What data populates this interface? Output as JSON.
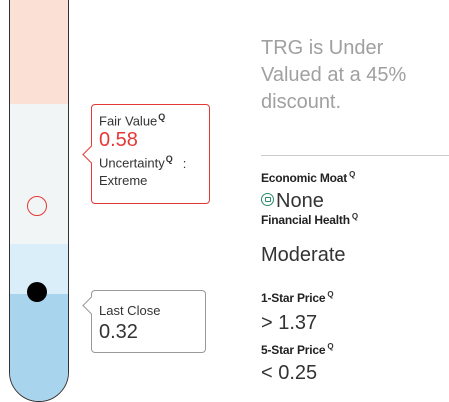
{
  "fair_value": {
    "label": "Fair Value",
    "value": "0.58",
    "uncertainty_label": "Uncertainty",
    "uncertainty_sep": ":",
    "uncertainty_value": "Extreme"
  },
  "last_close": {
    "label": "Last Close",
    "value": "0.32"
  },
  "summary": {
    "text": "TRG is Under Valued at a 45% discount."
  },
  "economic_moat": {
    "title": "Economic Moat",
    "value": "None"
  },
  "financial_health": {
    "title": "Financial Health",
    "value": "Moderate"
  },
  "one_star": {
    "title": "1-Star Price",
    "value": "> 1.37"
  },
  "five_star": {
    "title": "5-Star Price",
    "value": "< 0.25"
  },
  "help_icon_glyph": "Q",
  "colors": {
    "fair_value_red": "#e53935",
    "overvalued_band": "#fbe1d5",
    "undervalued_band": "#a9d4ee",
    "moat_icon": "#2a8a6a"
  }
}
